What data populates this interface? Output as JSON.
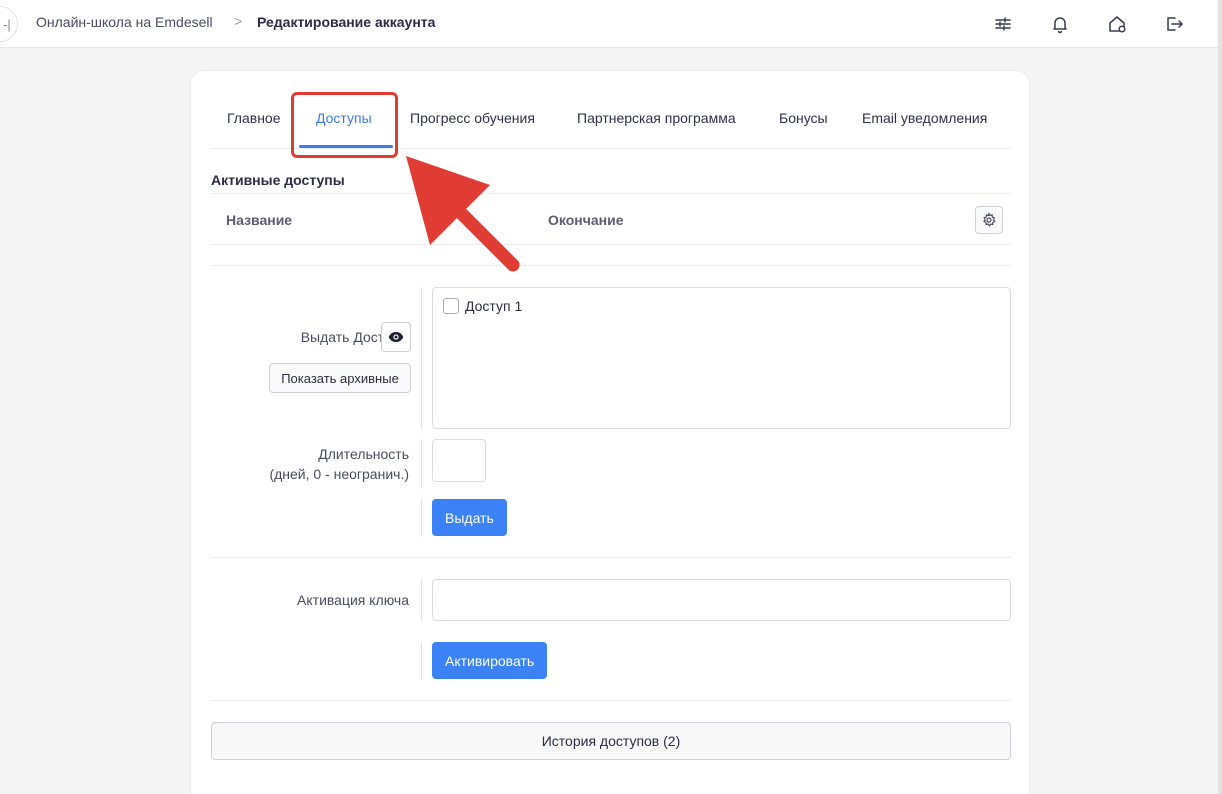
{
  "topbar": {
    "sidebar_stub_glyph": "-|",
    "breadcrumb_home": "Онлайн-школа на Emdesell",
    "breadcrumb_separator": ">",
    "breadcrumb_current": "Редактирование аккаунта",
    "icons": [
      "sliders-icon",
      "bell-icon",
      "home-settings-icon",
      "logout-icon"
    ]
  },
  "tabs": [
    {
      "label": "Главное",
      "active": false
    },
    {
      "label": "Доступы",
      "active": true
    },
    {
      "label": "Прогресс обучения",
      "active": false
    },
    {
      "label": "Партнерская программа",
      "active": false
    },
    {
      "label": "Бонусы",
      "active": false
    },
    {
      "label": "Email уведомления",
      "active": false
    }
  ],
  "active_access": {
    "title": "Активные доступы",
    "columns": [
      "Название",
      "Окончание"
    ]
  },
  "grant": {
    "label": "Выдать Доступы",
    "show_archived_label": "Показать архивные",
    "items": [
      {
        "label": "Доступ 1",
        "checked": false
      }
    ],
    "duration_label_line1": "Длительность",
    "duration_label_line2": "(дней, 0 - неогранич.)",
    "duration_value": "",
    "submit_label": "Выдать"
  },
  "key_activation": {
    "label": "Активация ключа",
    "value": "",
    "submit_label": "Активировать"
  },
  "history_button_label": "История доступов (2)",
  "colors": {
    "accent": "#3d7be8",
    "button_primary": "#3b82f6",
    "annotation_red": "#e13c33"
  }
}
